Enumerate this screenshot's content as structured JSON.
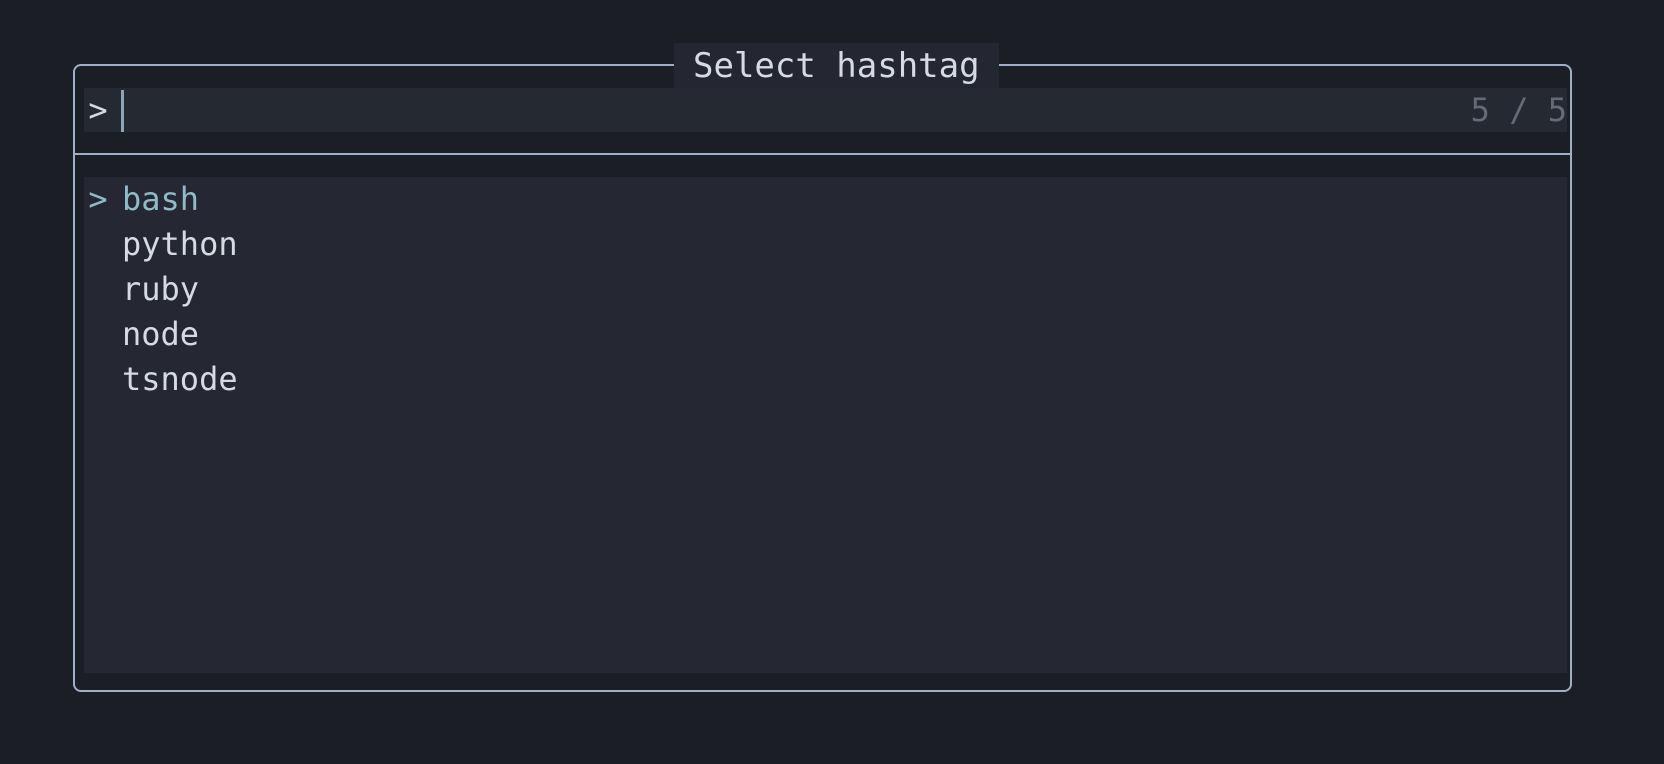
{
  "picker": {
    "title": "Select hashtag",
    "prompt_symbol": ">",
    "query": "",
    "match_count": "5 / 5"
  },
  "results": {
    "selected_marker": ">",
    "selected_index": 0,
    "items": [
      {
        "label": "bash"
      },
      {
        "label": "python"
      },
      {
        "label": "ruby"
      },
      {
        "label": "node"
      },
      {
        "label": "tsnode"
      }
    ]
  }
}
